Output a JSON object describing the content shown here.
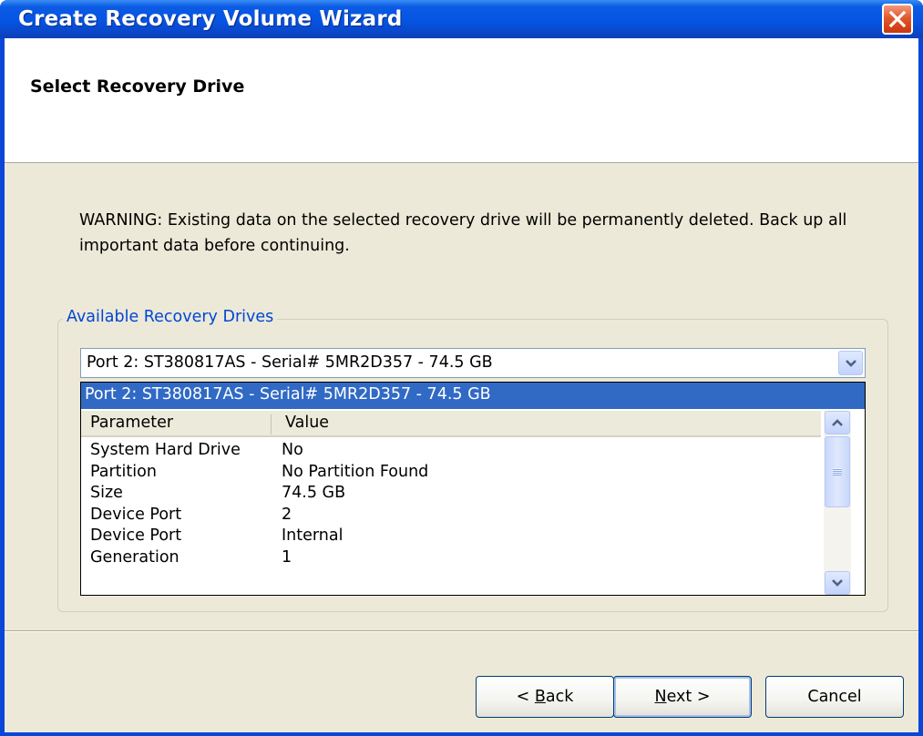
{
  "window": {
    "title": "Create Recovery Volume Wizard",
    "close_icon": "close-icon"
  },
  "header": {
    "title": "Select Recovery Drive"
  },
  "warning": "WARNING: Existing data on the selected recovery drive will be permanently deleted. Back up all important data before continuing.",
  "drives_group": {
    "label": "Available Recovery Drives",
    "selected_drive": "Port 2: ST380817AS - Serial# 5MR2D357 - 74.5 GB",
    "dropdown_items": [
      "Port 2: ST380817AS - Serial# 5MR2D357 - 74.5 GB"
    ],
    "columns": [
      "Parameter",
      "Value"
    ],
    "rows": [
      {
        "parameter": "System Hard Drive",
        "value": "No"
      },
      {
        "parameter": "Partition",
        "value": "No Partition Found"
      },
      {
        "parameter": "Size",
        "value": "74.5 GB"
      },
      {
        "parameter": "Device Port",
        "value": "2"
      },
      {
        "parameter": "Device Port",
        "value": "Internal"
      },
      {
        "parameter": "Generation",
        "value": "1"
      }
    ]
  },
  "buttons": {
    "back_prefix": "< ",
    "back_mnemonic": "B",
    "back_rest": "ack",
    "next_mnemonic": "N",
    "next_rest": "ext >",
    "cancel": "Cancel"
  },
  "colors": {
    "title_bar": "#0554e3",
    "selection": "#316ac5",
    "group_label": "#0046d5",
    "dialog_bg": "#ece9d8"
  }
}
